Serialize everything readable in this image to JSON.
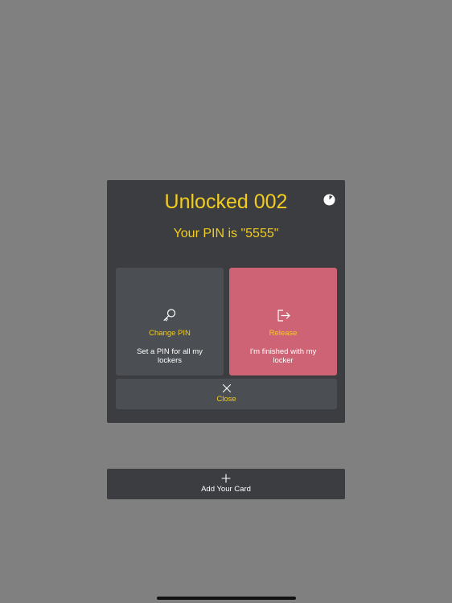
{
  "dialog": {
    "title": "Unlocked 002",
    "pin_text": "Your PIN is \"5555\"",
    "timer_icon": "timer-icon",
    "change_pin": {
      "icon": "key-icon",
      "title": "Change PIN",
      "description": "Set a PIN for all my lockers"
    },
    "release": {
      "icon": "exit-icon",
      "title": "Release",
      "description": "I'm finished with my locker"
    },
    "close": {
      "icon": "close-icon",
      "label": "Close"
    }
  },
  "add_card": {
    "icon": "plus-icon",
    "label": "Add Your Card"
  },
  "colors": {
    "background": "#808080",
    "panel": "#3b3d41",
    "tile": "#4b4e52",
    "release_tile": "#cd6374",
    "accent_yellow": "#f2cc1e",
    "text_white": "#ffffff"
  }
}
